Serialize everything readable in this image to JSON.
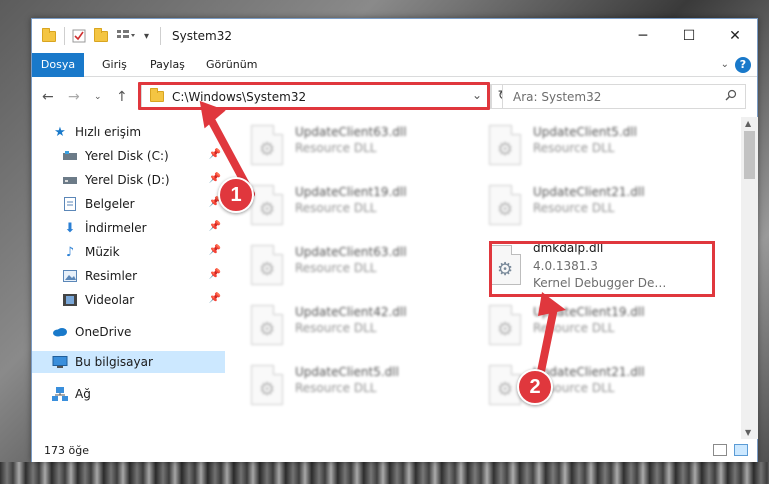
{
  "window": {
    "title": "System32",
    "controls": {
      "minimize": "─",
      "maximize": "☐",
      "close": "✕"
    }
  },
  "ribbon": {
    "tabs": [
      "Dosya",
      "Giriş",
      "Paylaş",
      "Görünüm"
    ],
    "help": "?"
  },
  "nav": {
    "address": "C:\\Windows\\System32",
    "search_placeholder": "Ara: System32"
  },
  "sidebar": {
    "items": [
      {
        "label": "Hızlı erişim",
        "icon": "star-icon"
      },
      {
        "label": "Yerel Disk (C:)",
        "icon": "drive-icon",
        "pinned": true
      },
      {
        "label": "Yerel Disk (D:)",
        "icon": "drive-icon",
        "pinned": true
      },
      {
        "label": "Belgeler",
        "icon": "documents-icon",
        "pinned": true
      },
      {
        "label": "İndirmeler",
        "icon": "download-icon",
        "pinned": true
      },
      {
        "label": "Müzik",
        "icon": "music-icon",
        "pinned": true
      },
      {
        "label": "Resimler",
        "icon": "pictures-icon",
        "pinned": true
      },
      {
        "label": "Videolar",
        "icon": "video-icon",
        "pinned": true
      },
      {
        "label": "OneDrive",
        "icon": "cloud-icon"
      },
      {
        "label": "Bu bilgisayar",
        "icon": "computer-icon",
        "selected": true
      },
      {
        "label": "Ağ",
        "icon": "network-icon"
      }
    ]
  },
  "files": [
    {
      "name": "UpdateClient63.dll",
      "line2": "Resource DLL"
    },
    {
      "name": "UpdateClient5.dll",
      "line2": "Resource DLL"
    },
    {
      "name": "UpdateClient19.dll",
      "line2": "Resource DLL"
    },
    {
      "name": "UpdateClient21.dll",
      "line2": "Resource DLL"
    },
    {
      "name": "UpdateClient63.dll",
      "line2": "Resource DLL"
    },
    {
      "name": "dmkdalp.dll",
      "line2": "4.0.1381.3",
      "line3": "Kernel Debugger Deb..."
    },
    {
      "name": "UpdateClient42.dll",
      "line2": "Resource DLL"
    },
    {
      "name": "UpdateClient19.dll",
      "line2": "Resource DLL"
    },
    {
      "name": "UpdateClient5.dll",
      "line2": "Resource DLL"
    },
    {
      "name": "UpdateClient21.dll",
      "line2": "Resource DLL"
    }
  ],
  "status": {
    "item_count": "173 öğe"
  },
  "annotations": {
    "step1": "1",
    "step2": "2",
    "color": "#e0373d"
  }
}
